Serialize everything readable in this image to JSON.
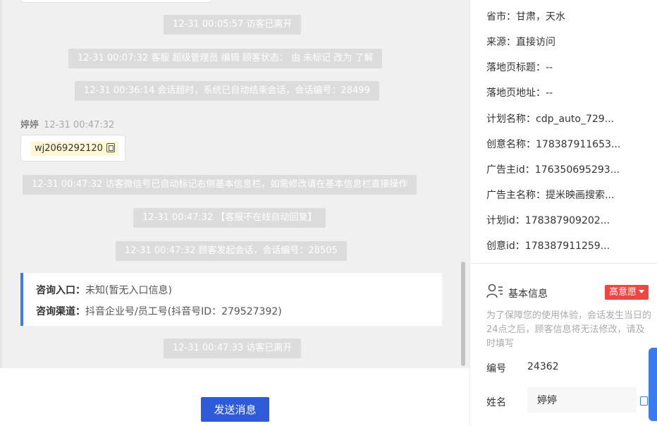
{
  "chat": {
    "system_messages": [
      "12-31 00:05:57 访客已离开",
      "12-31 00:07:32 客服 超级管理员 编辑 顾客状态： 由 未标记 改为 了解",
      "12-31 00:36:14 会话超时，系统已自动结束会话，会话编号：28499",
      "12-31 00:47:32 访客微信号已自动标记右侧基本信息栏，如需修改请在基本信息栏直接操作",
      "12-31 00:47:32 【客服不在线自动回复】",
      "12-31 00:47:32 顾客发起会话，会话编号：28505",
      "12-31 00:47:33 访客已离开"
    ],
    "sender_name": "婷婷",
    "sender_time": "12-31 00:47:32",
    "wechat_id": "wj2069292120",
    "consult": {
      "entry_label": "咨询入口：",
      "entry_value": "未知(暂无入口信息)",
      "channel_label": "咨询渠道：",
      "channel_value": "抖音企业号/员工号(抖音号ID：279527392)"
    },
    "send_button": "发送消息"
  },
  "side": {
    "fields": [
      {
        "label": "省市：",
        "value": "甘肃，天水"
      },
      {
        "label": "来源：",
        "value": "直接访问"
      },
      {
        "label": "落地页标题：",
        "value": "--"
      },
      {
        "label": "落地页地址：",
        "value": "--"
      },
      {
        "label": "计划名称：",
        "value": "cdp_auto_729..."
      },
      {
        "label": "创意名称：",
        "value": "178387911653..."
      },
      {
        "label": "广告主id：",
        "value": "176350695293..."
      },
      {
        "label": "广告主名称：",
        "value": "提米映画搜索..."
      },
      {
        "label": "计划id：",
        "value": "178387909202..."
      },
      {
        "label": "创意id：",
        "value": "178387911259..."
      }
    ],
    "basic_info_title": "基本信息",
    "intent_badge": "高意愿",
    "notice": "为了保障您的使用体验，会话发生当日的24点之后，顾客信息将无法修改，请及时填写",
    "number_label": "编号",
    "number_value": "24362",
    "name_label": "姓名",
    "name_value": "婷婷"
  },
  "colors": {
    "accent_blue": "#3a7bef",
    "send_button": "#2f5bd9",
    "badge_red": "#f04545",
    "system_bubble": "#dcdcdc"
  }
}
